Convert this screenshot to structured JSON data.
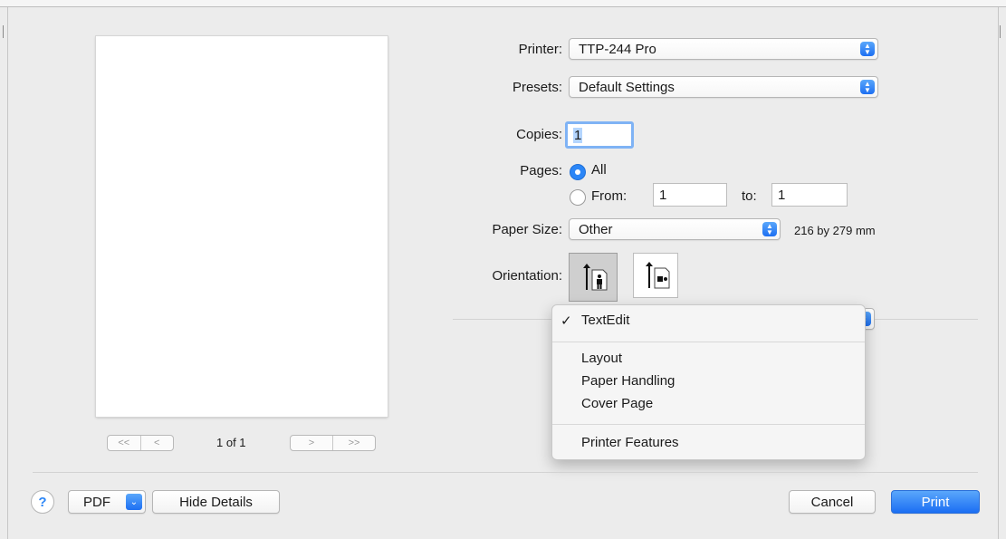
{
  "window": {
    "printer_label": "Printer:",
    "printer_value": "TTP-244 Pro",
    "presets_label": "Presets:",
    "presets_value": "Default Settings",
    "copies_label": "Copies:",
    "copies_value": "1",
    "pages_label": "Pages:",
    "pages_all": "All",
    "pages_from": "From:",
    "pages_from_value": "1",
    "pages_to": "to:",
    "pages_to_value": "1",
    "paper_label": "Paper Size:",
    "paper_value": "Other",
    "paper_dimensions": "216 by 279 mm",
    "orientation_label": "Orientation:"
  },
  "preview": {
    "first": "<<",
    "prev": "<",
    "next": ">",
    "last": ">>",
    "page_count": "1 of 1"
  },
  "menu": {
    "checkmark": "✓",
    "selected": "TextEdit",
    "items": [
      "Layout",
      "Paper Handling",
      "Cover Page"
    ],
    "last": "Printer Features"
  },
  "bottom": {
    "help": "?",
    "pdf": "PDF",
    "hide_details": "Hide Details",
    "cancel": "Cancel",
    "print": "Print"
  },
  "colors": {
    "accent": "#2b86f7",
    "primary_button": "#1b6ef3",
    "background": "#ececec"
  }
}
